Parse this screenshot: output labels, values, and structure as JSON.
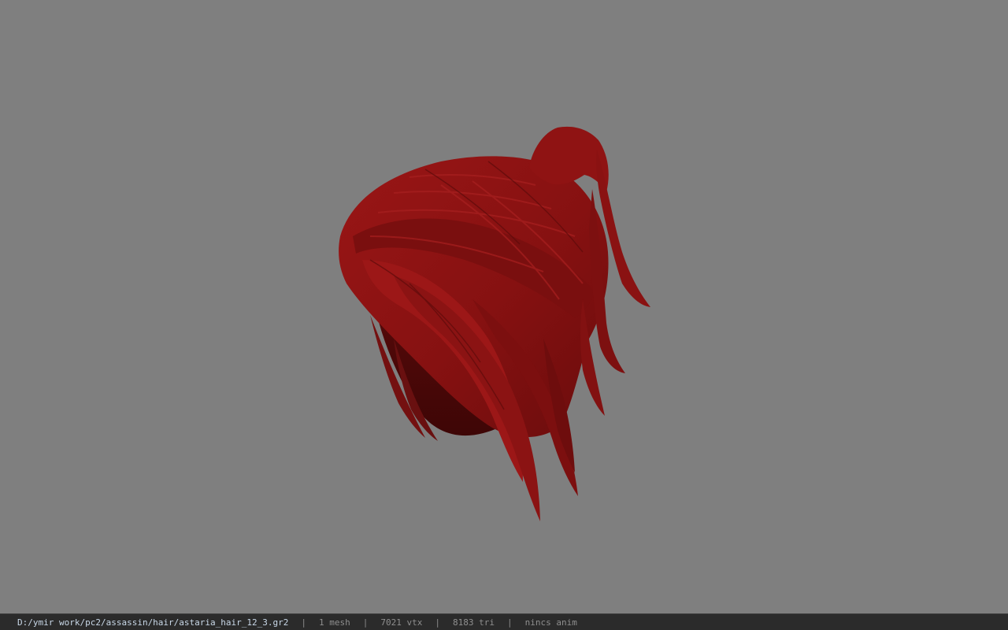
{
  "viewport": {
    "background": "#7f7f7f",
    "model_name": "hair-mesh",
    "model_color": "#8c1212"
  },
  "statusbar": {
    "file_path": "D:/ymir work/pc2/assassin/hair/astaria_hair_12_3.gr2",
    "separator": "|",
    "mesh_count": "1 mesh",
    "vertex_count": "7021 vtx",
    "triangle_count": "8183 tri",
    "anim_status": "nincs anim"
  }
}
